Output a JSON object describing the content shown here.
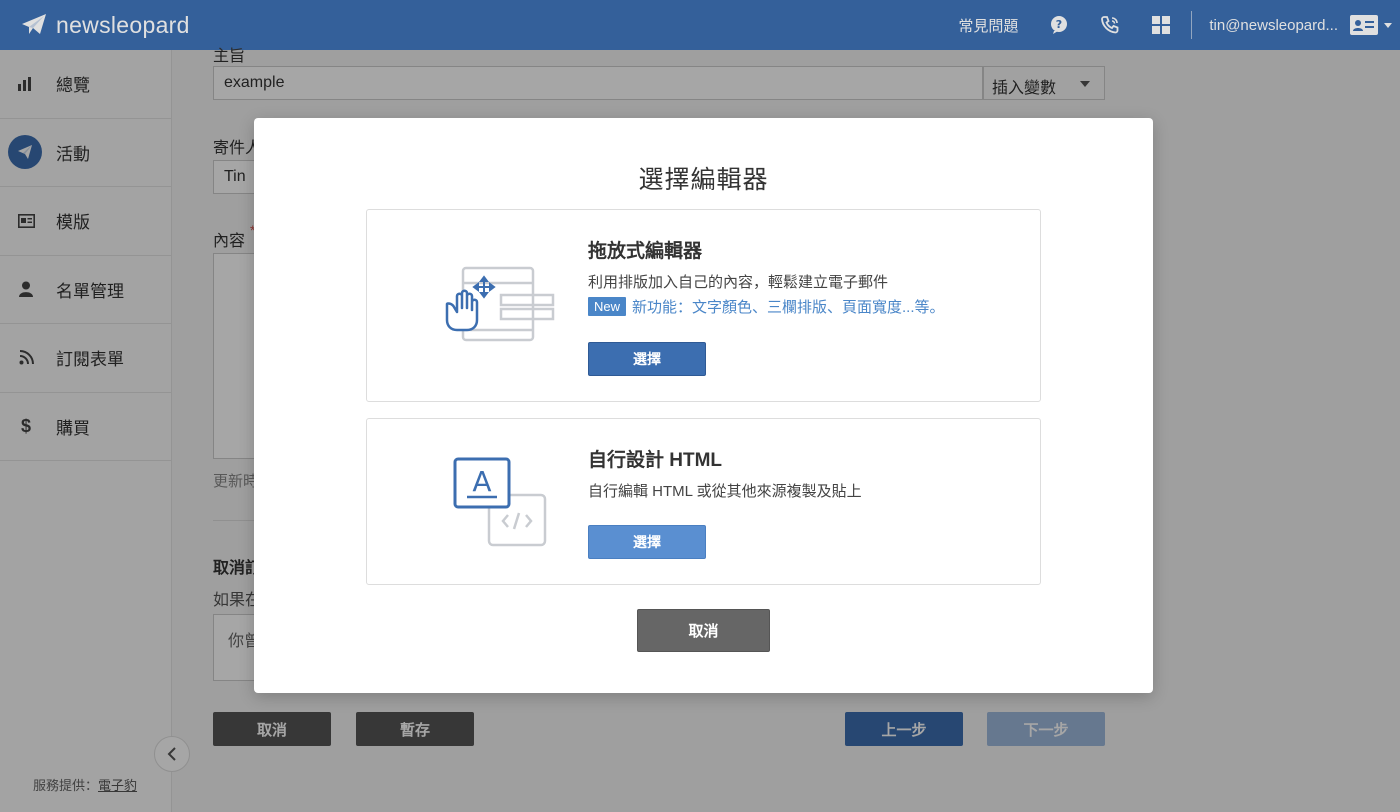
{
  "brand": {
    "name": "newsleopard"
  },
  "topbar": {
    "faq_label": "常見問題",
    "icons": [
      "chat-question-icon",
      "phone-icon",
      "apps-grid-icon"
    ],
    "user_email": "tin@newsleopard...",
    "accent": "#3c6eb0"
  },
  "sidebar": {
    "items": [
      {
        "label": "總覽",
        "icon": "bar-chart-icon"
      },
      {
        "label": "活動",
        "icon": "paper-plane-icon",
        "active": true
      },
      {
        "label": "模版",
        "icon": "template-icon"
      },
      {
        "label": "名單管理",
        "icon": "person-icon"
      },
      {
        "label": "訂閱表單",
        "icon": "rss-icon"
      },
      {
        "label": "購買",
        "icon": "dollar-icon"
      }
    ],
    "footer_prefix": "服務提供：",
    "footer_link": "電子豹"
  },
  "form": {
    "subject_label": "主旨",
    "subject_value": "example",
    "insert_variable": "插入變數",
    "sender_label": "寄件人",
    "sender_value": "Tin",
    "content_label": "內容",
    "updated_prefix": "更新時",
    "unsubscribe_label": "取消訂",
    "unsubscribe_hint": "如果在",
    "unsubscribe_text": "你曾",
    "cancel_button": "取消",
    "save_button": "暫存",
    "prev_button": "上一步",
    "next_button": "下一步"
  },
  "modal": {
    "title": "選擇編輯器",
    "cards": [
      {
        "title": "拖放式編輯器",
        "description": "利用排版加入自己的內容，輕鬆建立電子郵件",
        "new_badge": "New",
        "new_text": "新功能：文字顏色、三欄排版、頁面寬度...等。",
        "button": "選擇",
        "illustration": "drag-drop-editor-icon"
      },
      {
        "title": "自行設計 HTML",
        "description": "自行編輯 HTML 或從其他來源複製及貼上",
        "button": "選擇",
        "illustration": "html-code-editor-icon"
      }
    ],
    "cancel_button": "取消"
  }
}
